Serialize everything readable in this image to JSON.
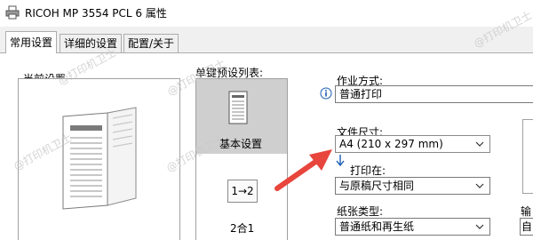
{
  "window": {
    "title": "RICOH MP 3554 PCL 6 属性",
    "icon": "printer-icon"
  },
  "tabs": [
    {
      "label": "常用设置",
      "active": true
    },
    {
      "label": "详细的设置",
      "active": false
    },
    {
      "label": "配置/关于",
      "active": false
    }
  ],
  "current_settings": {
    "label": "当前设置"
  },
  "presets": {
    "label": "单键预设列表:",
    "items": [
      {
        "label": "基本设置",
        "selected": true,
        "icon": "document-icon"
      },
      {
        "label": "2合1",
        "selected": false,
        "icon": "two-in-one-icon",
        "icon_text": "1→2"
      }
    ]
  },
  "job_type": {
    "label": "作业方式:",
    "value": "普通打印"
  },
  "document_size": {
    "label": "文件尺寸:",
    "value": "A4 (210 x 297 mm)"
  },
  "print_on": {
    "label": "打印在:",
    "value": "与原稿尺寸相同"
  },
  "paper_type": {
    "label": "纸张类型:",
    "value": "普通纸和再生纸"
  },
  "right_column": {
    "label_top": "打",
    "label_bottom": "输",
    "value_bottom": "自"
  },
  "watermark": {
    "text": "@打印机卫士"
  },
  "colors": {
    "annotation_arrow": "#e8453c",
    "selection": "#cfcfcf",
    "info_icon": "#1a5fb4"
  }
}
